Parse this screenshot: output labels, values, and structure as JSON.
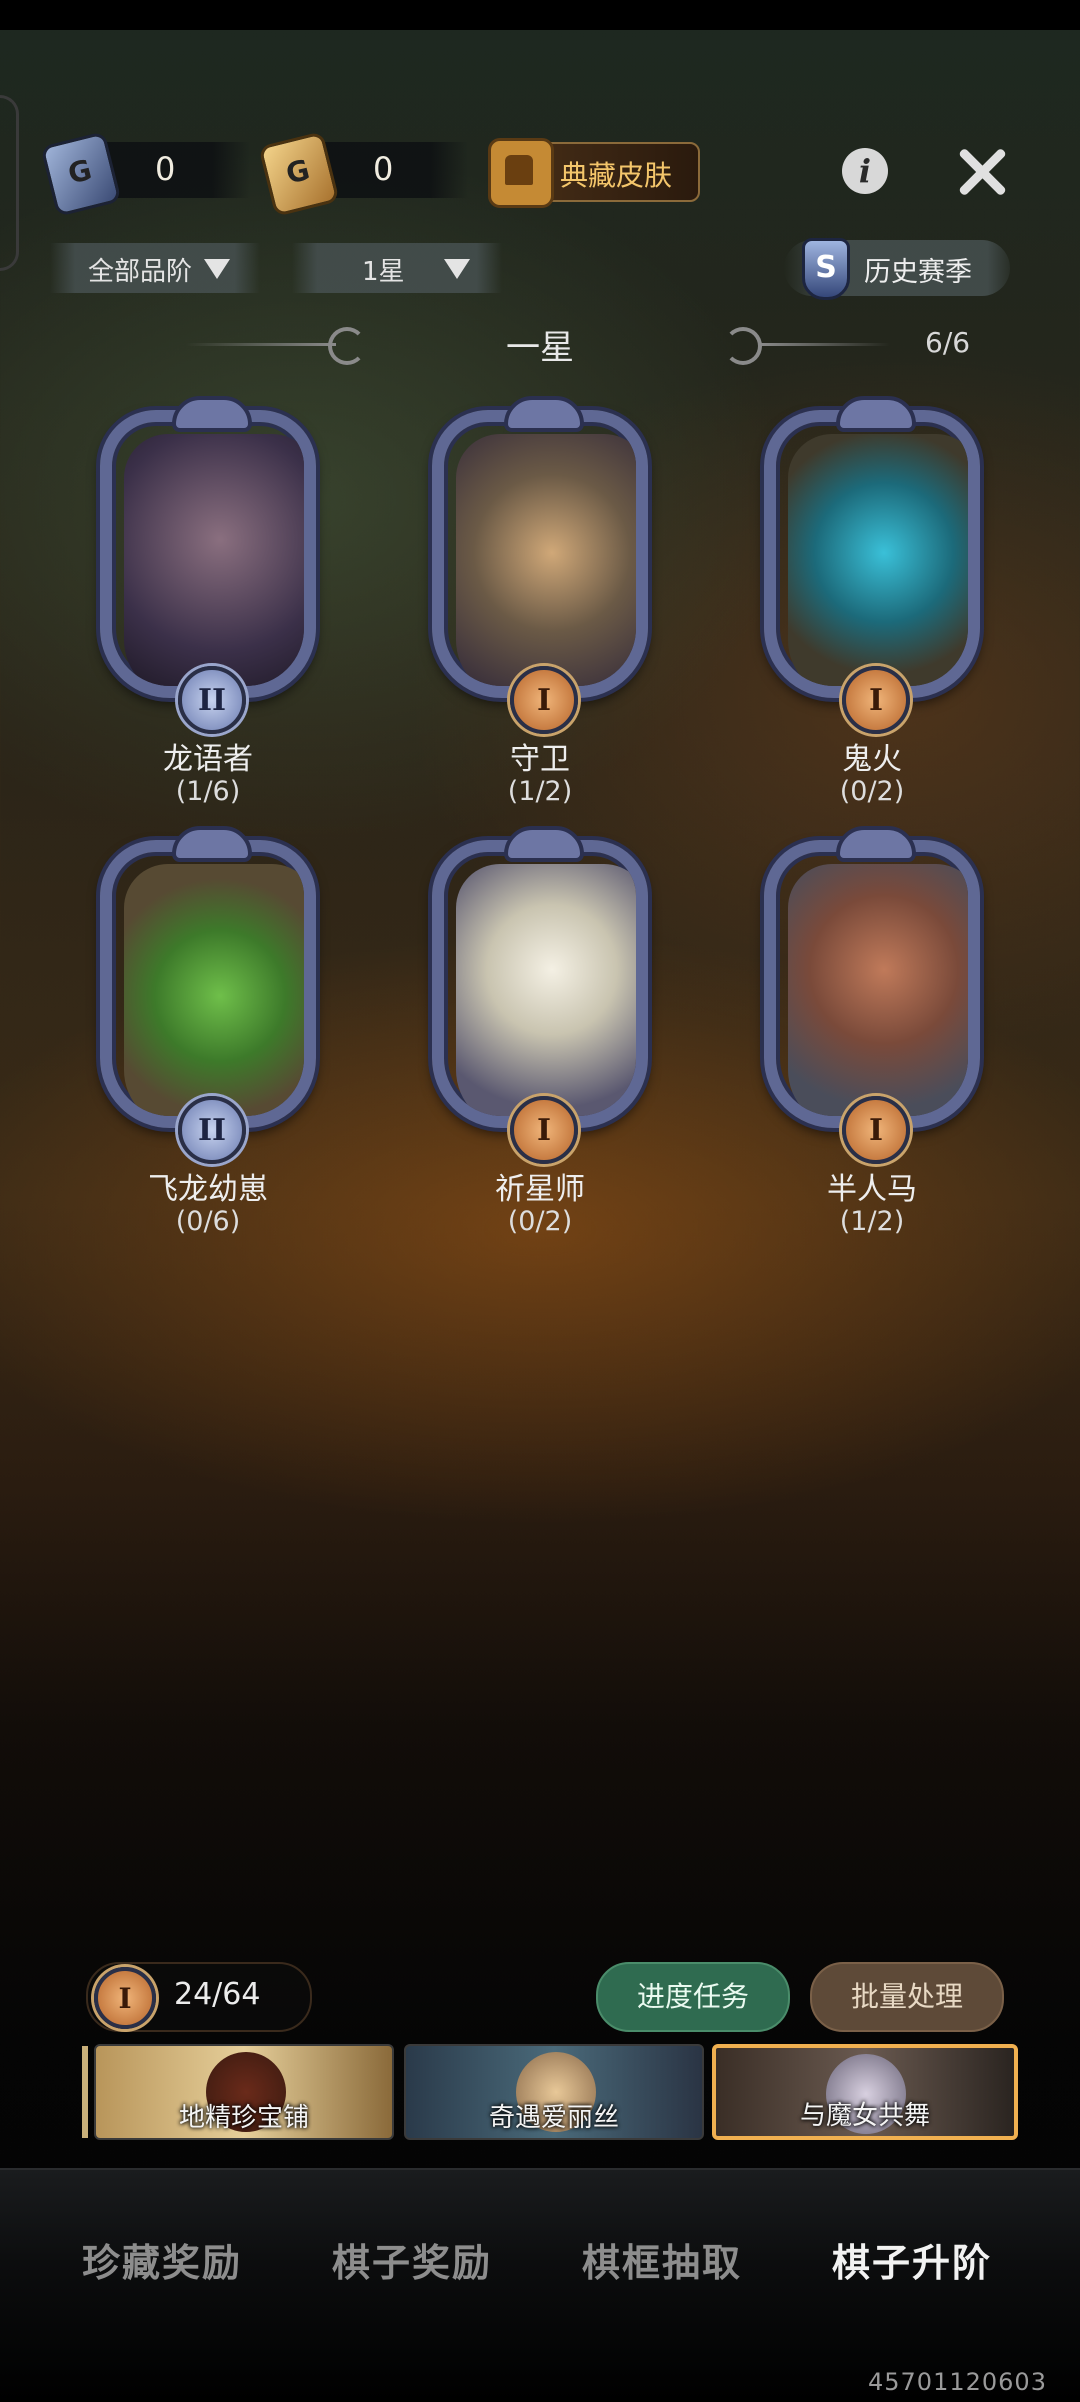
{
  "currency": {
    "blue_value": "0",
    "gold_value": "0",
    "blue_icon": "blue-card-icon",
    "gold_icon": "gold-card-icon"
  },
  "header": {
    "skin_button_label": "典藏皮肤",
    "info_icon_glyph": "i"
  },
  "filters": {
    "quality_label": "全部品阶",
    "star_label": "1星",
    "history_label": "历史赛季",
    "history_badge": "S"
  },
  "section": {
    "title": "一星",
    "count": "6/6"
  },
  "cards": [
    {
      "name": "龙语者",
      "progress": "(1/6)",
      "rank": "II",
      "portrait_color": "#3b3049"
    },
    {
      "name": "守卫",
      "progress": "(1/2)",
      "rank": "I",
      "portrait_color": "#6b5a46"
    },
    {
      "name": "鬼火",
      "progress": "(0/2)",
      "rank": "I",
      "portrait_color": "#3f3a2c"
    },
    {
      "name": "飞龙幼崽",
      "progress": "(0/6)",
      "rank": "II",
      "portrait_color": "#574a33"
    },
    {
      "name": "祈星师",
      "progress": "(0/2)",
      "rank": "I",
      "portrait_color": "#5a5870"
    },
    {
      "name": "半人马",
      "progress": "(1/2)",
      "rank": "I",
      "portrait_color": "#4a4d5a"
    }
  ],
  "bottom": {
    "level_rank": "I",
    "level_text": "24/64",
    "task_button": "进度任务",
    "batch_button": "批量处理"
  },
  "banners": [
    {
      "label": "地精珍宝铺",
      "selected": false
    },
    {
      "label": "奇遇爱丽丝",
      "selected": false
    },
    {
      "label": "与魔女共舞",
      "selected": true
    }
  ],
  "nav": {
    "items": [
      "珍藏奖励",
      "棋子奖励",
      "棋框抽取",
      "棋子升阶"
    ],
    "active_index": 3
  },
  "uid": "45701120603",
  "colors": {
    "accent_gold": "#f4c66b",
    "frame_blue": "#5f6894",
    "task_green": "#2f6b50",
    "batch_brown": "#5e4a38"
  }
}
